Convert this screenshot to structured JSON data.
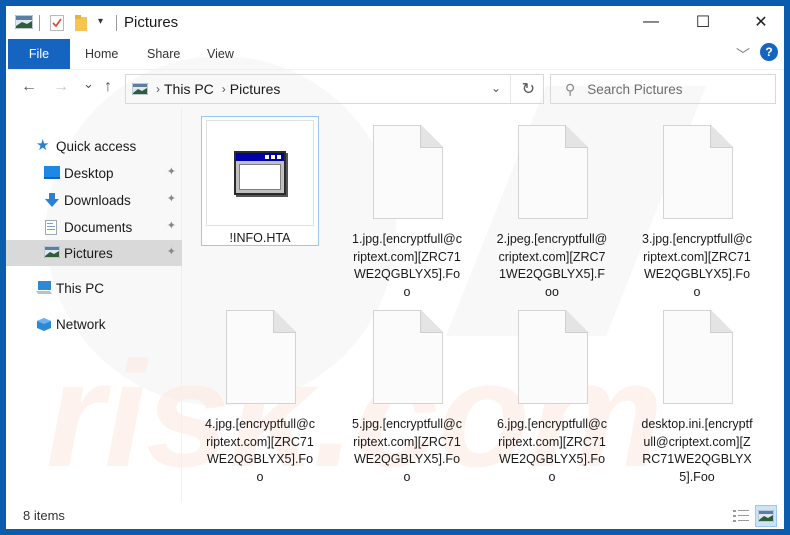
{
  "window": {
    "title": "Pictures",
    "controls": {
      "minimize": "—",
      "maximize": "☐",
      "close": "✕"
    }
  },
  "quick_access_toolbar": {
    "icons": [
      "pictures-folder-icon",
      "properties-icon",
      "new-folder-icon",
      "customize-dropdown-icon"
    ]
  },
  "ribbon": {
    "tabs": [
      {
        "label": "File",
        "active": true
      },
      {
        "label": "Home"
      },
      {
        "label": "Share"
      },
      {
        "label": "View"
      }
    ],
    "expand_glyph": "﹀",
    "help_glyph": "?"
  },
  "nav": {
    "back": "←",
    "forward": "→",
    "recent": "⌄",
    "up": "↑",
    "breadcrumb": [
      "This PC",
      "Pictures"
    ],
    "breadcrumb_sep": "›",
    "refresh": "↻",
    "dropdown": "⌄",
    "search_placeholder": "Search Pictures",
    "search_value": ""
  },
  "sidebar": {
    "quick_access": "Quick access",
    "items": [
      {
        "label": "Desktop",
        "pinned": true
      },
      {
        "label": "Downloads",
        "pinned": true
      },
      {
        "label": "Documents",
        "pinned": true
      },
      {
        "label": "Pictures",
        "pinned": true,
        "selected": true
      }
    ],
    "this_pc": "This PC",
    "network": "Network",
    "pin_glyph": "📌"
  },
  "files": [
    {
      "name": "!INFO.HTA",
      "type": "hta"
    },
    {
      "name": "1.jpg.[encryptfull@criptext.com][ZRC71WE2QGBLYX5].Foo",
      "type": "blank"
    },
    {
      "name": "2.jpeg.[encryptfull@criptext.com][ZRC71WE2QGBLYX5].Foo",
      "type": "blank"
    },
    {
      "name": "3.jpg.[encryptfull@criptext.com][ZRC71WE2QGBLYX5].Foo",
      "type": "blank"
    },
    {
      "name": "4.jpg.[encryptfull@criptext.com][ZRC71WE2QGBLYX5].Foo",
      "type": "blank"
    },
    {
      "name": "5.jpg.[encryptfull@criptext.com][ZRC71WE2QGBLYX5].Foo",
      "type": "blank"
    },
    {
      "name": "6.jpg.[encryptfull@criptext.com][ZRC71WE2QGBLYX5].Foo",
      "type": "blank"
    },
    {
      "name": "desktop.ini.[encryptfull@criptext.com][ZRC71WE2QGBLYX5].Foo",
      "type": "blank"
    }
  ],
  "status": {
    "item_count": "8 items",
    "view_modes": [
      "details-view",
      "large-icons-view"
    ],
    "active_view": "large-icons-view"
  },
  "colors": {
    "frame": "#0b5cad",
    "accent": "#1565c0",
    "selection": "#cce4f7"
  }
}
